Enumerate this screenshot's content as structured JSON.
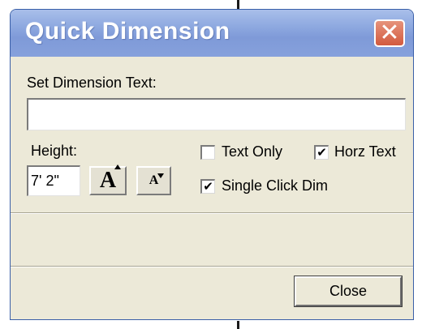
{
  "window": {
    "title": "Quick Dimension",
    "close_glyph": "✕"
  },
  "form": {
    "dimension_text_label": "Set Dimension Text:",
    "dimension_text_value": "",
    "height_label": "Height:",
    "height_value": "7' 2\"",
    "increase_font_glyph": "A",
    "decrease_font_glyph": "A"
  },
  "options": {
    "text_only": {
      "label": "Text Only",
      "checked": false
    },
    "horz_text": {
      "label": "Horz Text",
      "checked": true
    },
    "single_click_dim": {
      "label": "Single Click Dim",
      "checked": true
    }
  },
  "footer": {
    "close_label": "Close"
  },
  "colors": {
    "titlebar": "#8ea9e0",
    "close_x": "#d25a3e",
    "dialog_bg": "#ece9d8"
  },
  "icons": {
    "close": "close-icon",
    "increase_font": "increase-font-icon",
    "decrease_font": "decrease-font-icon"
  }
}
